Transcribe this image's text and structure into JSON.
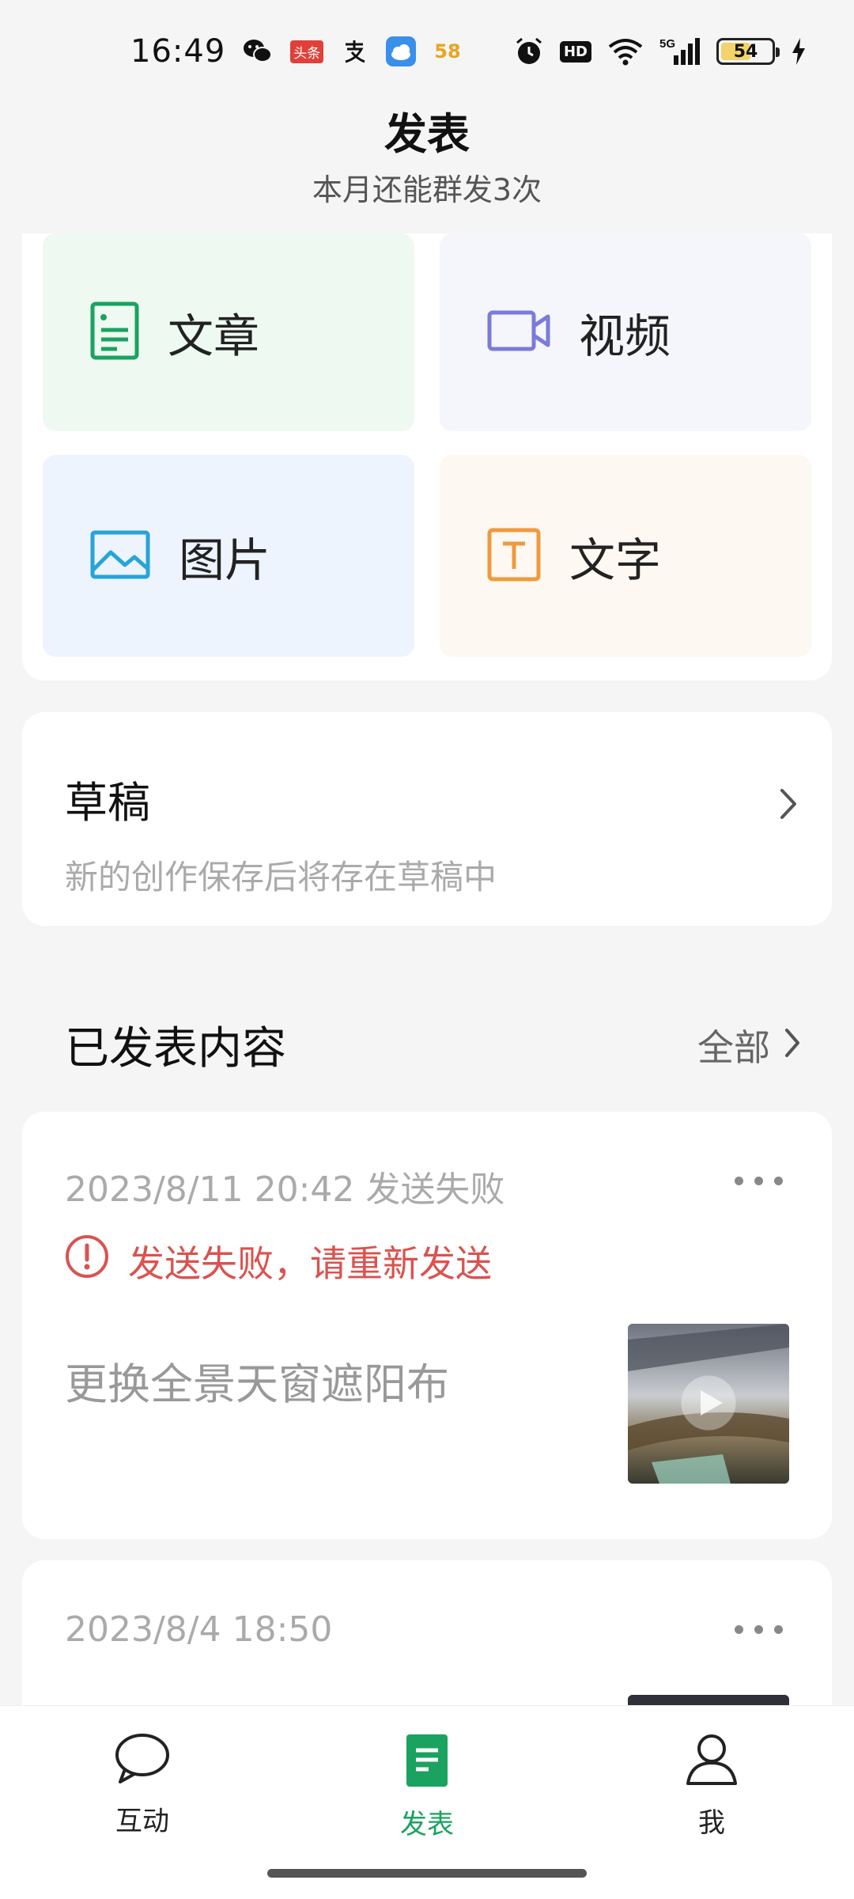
{
  "status_bar": {
    "time": "16:49",
    "battery_level": "54",
    "network": "5G",
    "icons": [
      "wechat-icon",
      "toutiao-icon",
      "alipay-icon",
      "weather-icon",
      "58-icon",
      "alarm-icon",
      "hd-icon",
      "wifi-icon",
      "signal-icon",
      "battery-icon",
      "charging-icon"
    ],
    "badge_toutiao": "头条",
    "badge_58": "58",
    "badge_hd": "HD"
  },
  "header": {
    "title": "发表",
    "subtitle": "本月还能群发3次"
  },
  "create": {
    "items": [
      {
        "label": "文章",
        "icon": "article-icon",
        "color": "#1aa260"
      },
      {
        "label": "视频",
        "icon": "video-icon",
        "color": "#7b7bdc"
      },
      {
        "label": "图片",
        "icon": "image-icon",
        "color": "#27a4d8"
      },
      {
        "label": "文字",
        "icon": "text-icon",
        "color": "#f09a3e"
      }
    ]
  },
  "drafts": {
    "title": "草稿",
    "description": "新的创作保存后将存在草稿中"
  },
  "published": {
    "title": "已发表内容",
    "all_label": "全部",
    "posts": [
      {
        "meta": "2023/8/11 20:42 发送失败",
        "error": "发送失败，请重新发送",
        "text": "更换全景天窗遮阳布"
      },
      {
        "meta": "2023/8/4 18:50",
        "text": ""
      }
    ]
  },
  "bottom_nav": {
    "items": [
      {
        "label": "互动",
        "icon": "chat-bubble-icon"
      },
      {
        "label": "发表",
        "icon": "publish-icon",
        "active": true
      },
      {
        "label": "我",
        "icon": "person-icon"
      }
    ]
  },
  "colors": {
    "accent": "#1aa260",
    "error": "#d9534f",
    "background": "#f5f5f5"
  }
}
